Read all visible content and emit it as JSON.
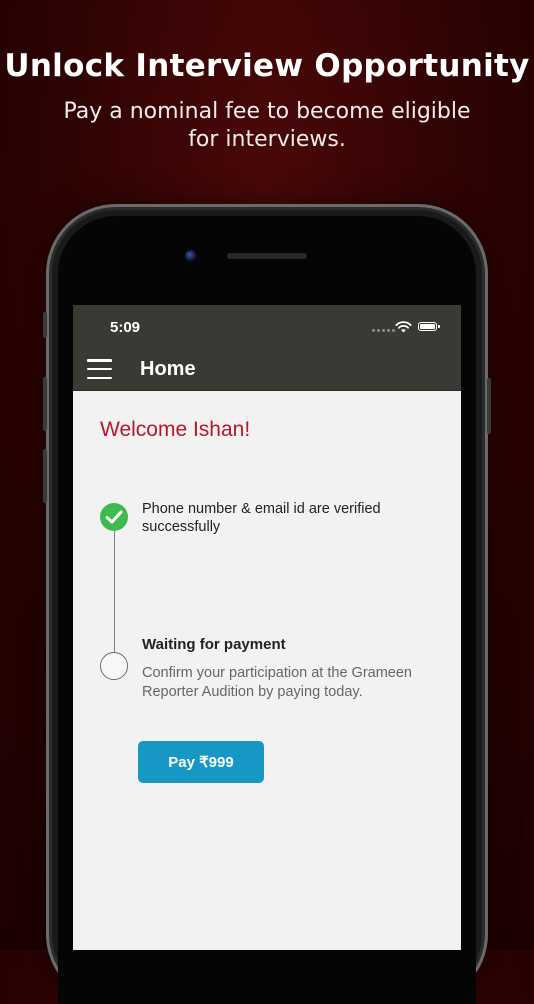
{
  "promo": {
    "headline": "Unlock Interview Opportunity",
    "subline": "Pay a nominal fee to become eligible for interviews."
  },
  "status_bar": {
    "time": "5:09",
    "icons": [
      "signal-dots-icon",
      "wifi-icon",
      "battery-icon"
    ]
  },
  "app_bar": {
    "menu_icon": "hamburger-menu-icon",
    "title": "Home"
  },
  "main": {
    "welcome": "Welcome Ishan!",
    "steps": [
      {
        "status": "completed",
        "icon": "check-icon",
        "text": "Phone number & email id are verified successfully"
      },
      {
        "status": "pending",
        "icon": "pending-circle-icon",
        "title": "Waiting for payment",
        "description": "Confirm your participation at the Grameen Reporter Audition by paying today."
      }
    ],
    "pay_button_label": "Pay ₹999"
  },
  "colors": {
    "background": "#2e0303",
    "app_bar": "#3a3a34",
    "welcome_text": "#b3192b",
    "check_green": "#3dbb4c",
    "pay_button": "#1798c4"
  }
}
